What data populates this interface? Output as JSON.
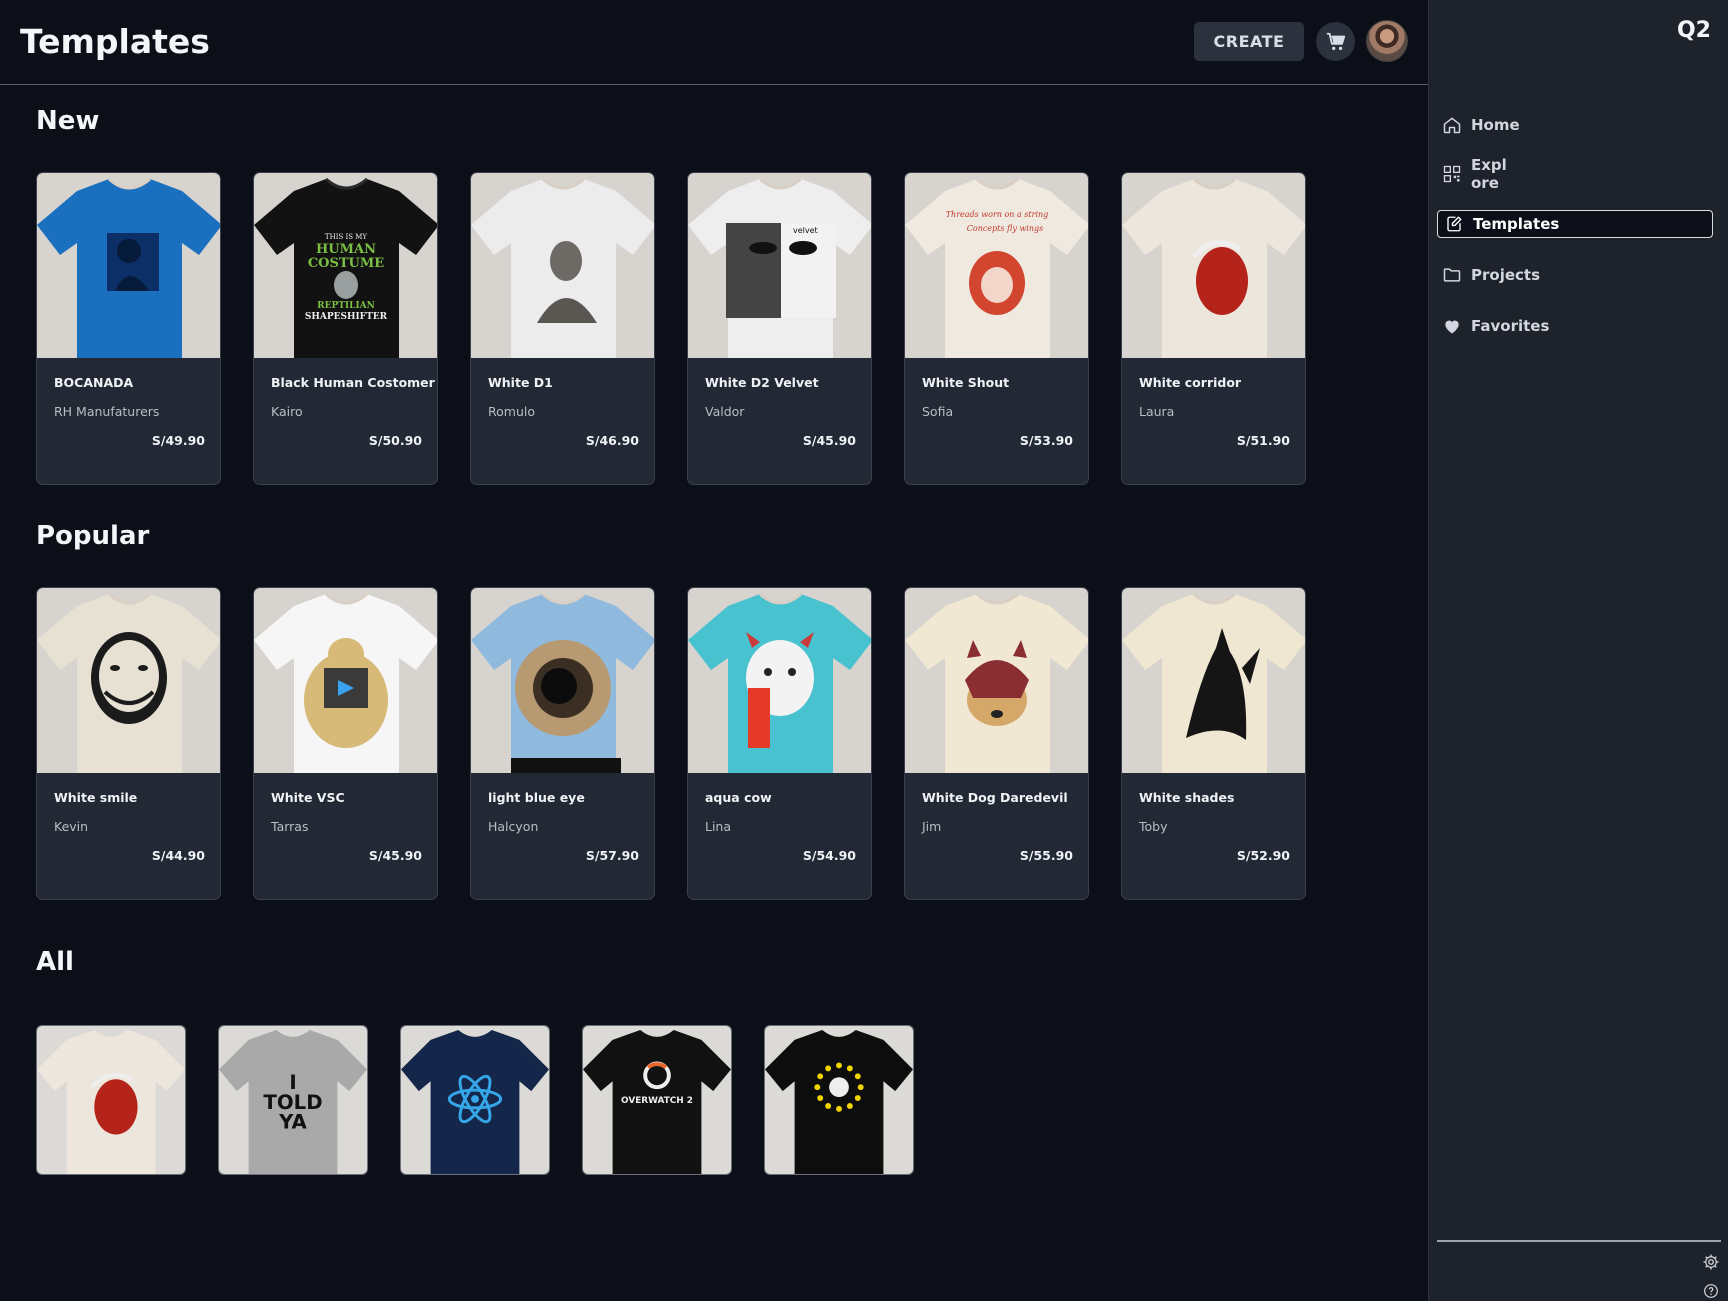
{
  "header": {
    "title": "Templates",
    "create_label": "CREATE",
    "cart_icon": "cart-icon",
    "avatar_icon": "avatar"
  },
  "sections": {
    "new": {
      "title": "New",
      "items": [
        {
          "name": "BOCANADA",
          "author": "RH Manufaturers",
          "price": "S/49.90",
          "shirt_color": "#1a6fbf"
        },
        {
          "name": "Black Human Costomer",
          "author": "Kairo",
          "price": "S/50.90",
          "shirt_color": "#121212"
        },
        {
          "name": "White D1",
          "author": "Romulo",
          "price": "S/46.90",
          "shirt_color": "#ececec"
        },
        {
          "name": "White D2 Velvet",
          "author": "Valdor",
          "price": "S/45.90",
          "shirt_color": "#eeeeee"
        },
        {
          "name": "White Shout",
          "author": "Sofia",
          "price": "S/53.90",
          "shirt_color": "#efe9e0"
        },
        {
          "name": "White corridor",
          "author": "Laura",
          "price": "S/51.90",
          "shirt_color": "#ede6dc"
        }
      ]
    },
    "popular": {
      "title": "Popular",
      "items": [
        {
          "name": "White smile",
          "author": "Kevin",
          "price": "S/44.90",
          "shirt_color": "#e6e1d3"
        },
        {
          "name": "White VSC",
          "author": "Tarras",
          "price": "S/45.90",
          "shirt_color": "#f6f6f6"
        },
        {
          "name": "light blue eye",
          "author": "Halcyon",
          "price": "S/57.90",
          "shirt_color": "#8fb9dd"
        },
        {
          "name": "aqua cow",
          "author": "Lina",
          "price": "S/54.90",
          "shirt_color": "#49c2cf"
        },
        {
          "name": "White Dog Daredevil",
          "author": "Jim",
          "price": "S/55.90",
          "shirt_color": "#f1e8d4"
        },
        {
          "name": "White shades",
          "author": "Toby",
          "price": "S/52.90",
          "shirt_color": "#efe7d2"
        }
      ]
    },
    "all": {
      "title": "All",
      "items": [
        {
          "shirt_color": "#ede6dc",
          "print": "red-head"
        },
        {
          "shirt_color": "#a9a9a9",
          "print_text": "I TOLD YA"
        },
        {
          "shirt_color": "#14264a",
          "print": "react-atom"
        },
        {
          "shirt_color": "#111111",
          "print_text": "OVERWATCH 2"
        },
        {
          "shirt_color": "#0d0d0d",
          "print": "yellow-dots"
        }
      ]
    }
  },
  "sidebar": {
    "brand": "Q2",
    "items": [
      {
        "label": "Home",
        "icon": "home-icon"
      },
      {
        "label": "Expl\nore",
        "label_a": "Expl",
        "label_b": "ore",
        "icon": "qr-grid-icon"
      },
      {
        "label": "Templates",
        "icon": "template-edit-icon",
        "active": true
      },
      {
        "label": "Projects",
        "icon": "folder-icon"
      },
      {
        "label": "Favorites",
        "icon": "heart-icon"
      }
    ],
    "settings_icon": "gear-icon",
    "help_icon": "help-icon"
  }
}
